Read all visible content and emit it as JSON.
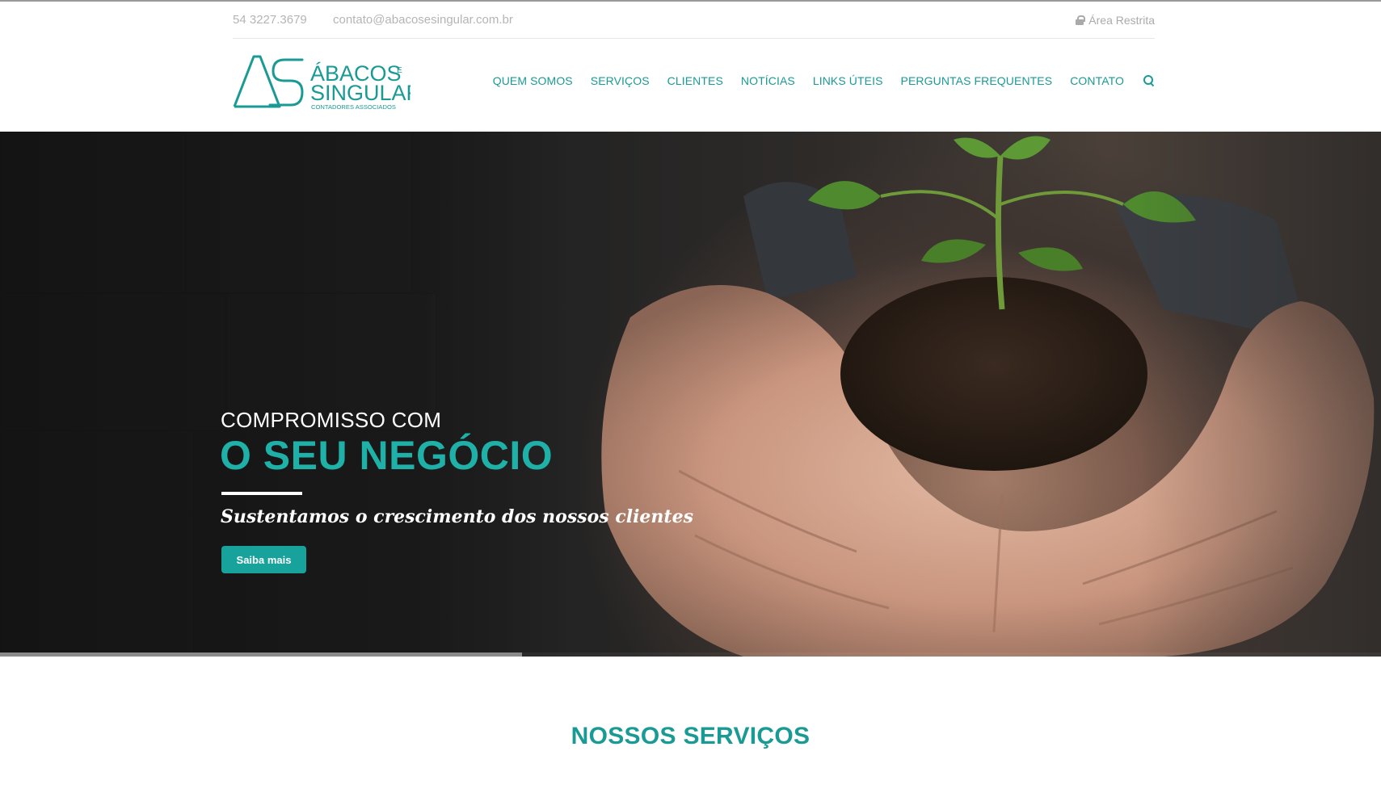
{
  "topbar": {
    "phone": "54 3227.3679",
    "email": "contato@abacosesingular.com.br",
    "restricted_area": "Área Restrita"
  },
  "logo": {
    "monogram": "AS",
    "name_line1": "ÁBACOS",
    "name_conj": "E",
    "name_line2": "SINGULAR",
    "subtitle": "CONTADORES ASSOCIADOS"
  },
  "nav": {
    "items": [
      {
        "label": "QUEM SOMOS"
      },
      {
        "label": "SERVIÇOS"
      },
      {
        "label": "CLIENTES"
      },
      {
        "label": "NOTÍCIAS"
      },
      {
        "label": "LINKS ÚTEIS"
      },
      {
        "label": "PERGUNTAS FREQUENTES"
      },
      {
        "label": "CONTATO"
      }
    ],
    "search_icon": "search-icon"
  },
  "hero": {
    "line1": "COMPROMISSO COM",
    "line2": "O SEU NEGÓCIO",
    "tagline": "Sustentamos o crescimento dos nossos clientes",
    "cta_label": "Saiba mais",
    "slide_progress": 0.378
  },
  "services": {
    "title": "NOSSOS SERVIÇOS"
  },
  "colors": {
    "brand": "#1a9a94",
    "button": "#17a39c",
    "muted": "#b5b5b5"
  }
}
